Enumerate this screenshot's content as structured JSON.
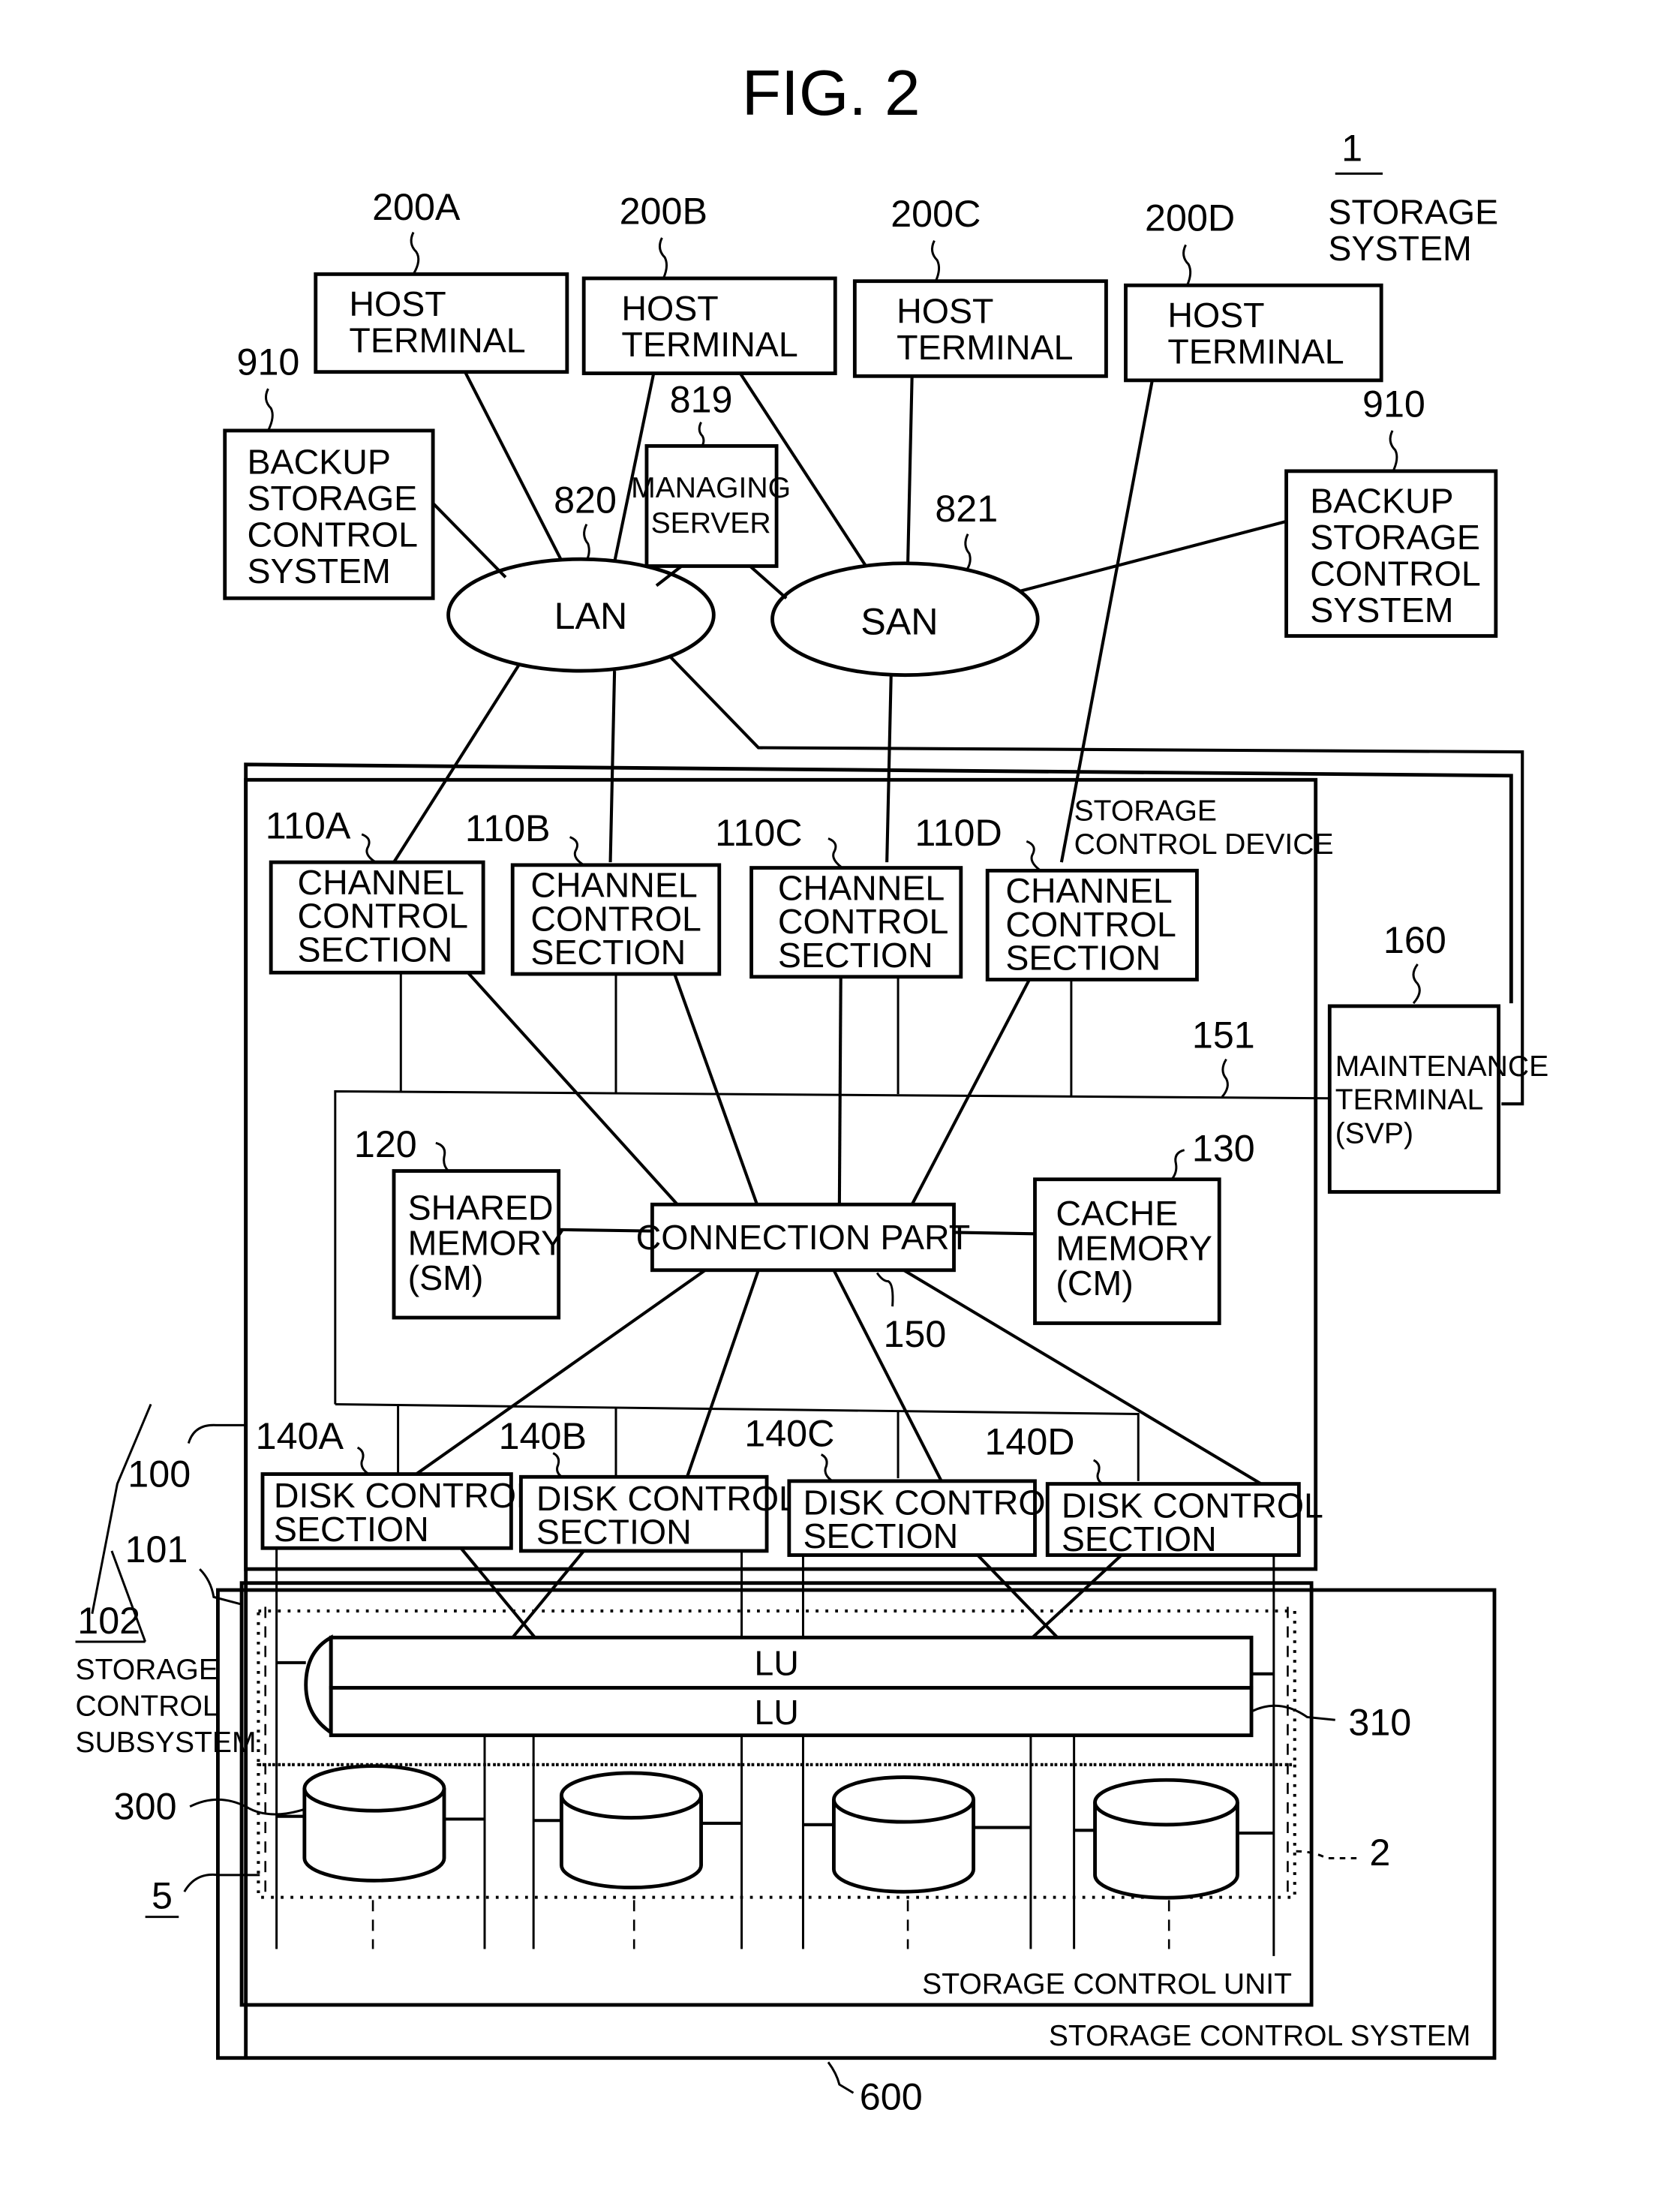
{
  "figure": {
    "title": "FIG. 2",
    "system_ref": "1",
    "system_label": [
      "STORAGE",
      "SYSTEM"
    ]
  },
  "hosts": [
    {
      "ref": "200A",
      "label": [
        "HOST",
        "TERMINAL"
      ]
    },
    {
      "ref": "200B",
      "label": [
        "HOST",
        "TERMINAL"
      ]
    },
    {
      "ref": "200C",
      "label": [
        "HOST",
        "TERMINAL"
      ]
    },
    {
      "ref": "200D",
      "label": [
        "HOST",
        "TERMINAL"
      ]
    }
  ],
  "backup_left": {
    "ref": "910",
    "label": [
      "BACKUP",
      "STORAGE",
      "CONTROL",
      "SYSTEM"
    ]
  },
  "backup_right": {
    "ref": "910",
    "label": [
      "BACKUP",
      "STORAGE",
      "CONTROL",
      "SYSTEM"
    ]
  },
  "managing_server": {
    "ref": "819",
    "label": [
      "MANAGING",
      "SERVER"
    ]
  },
  "lan": {
    "ref": "820",
    "label": "LAN"
  },
  "san": {
    "ref": "821",
    "label": "SAN"
  },
  "storage_control_device": {
    "label": [
      "STORAGE",
      "CONTROL DEVICE"
    ]
  },
  "channel_sections": [
    {
      "ref": "110A",
      "label": [
        "CHANNEL",
        "CONTROL",
        "SECTION"
      ]
    },
    {
      "ref": "110B",
      "label": [
        "CHANNEL",
        "CONTROL",
        "SECTION"
      ]
    },
    {
      "ref": "110C",
      "label": [
        "CHANNEL",
        "CONTROL",
        "SECTION"
      ]
    },
    {
      "ref": "110D",
      "label": [
        "CHANNEL",
        "CONTROL",
        "SECTION"
      ]
    }
  ],
  "internal_lan_ref": "151",
  "maintenance_terminal": {
    "ref": "160",
    "label": [
      "MAINTENANCE",
      "TERMINAL",
      "(SVP)"
    ]
  },
  "shared_memory": {
    "ref": "120",
    "label": [
      "SHARED",
      "MEMORY",
      "(SM)"
    ]
  },
  "connection_part": {
    "ref": "150",
    "label": "CONNECTION PART"
  },
  "cache_memory": {
    "ref": "130",
    "label": [
      "CACHE",
      "MEMORY",
      "(CM)"
    ]
  },
  "disk_sections": [
    {
      "ref": "140A",
      "label": [
        "DISK CONTROL",
        "SECTION"
      ]
    },
    {
      "ref": "140B",
      "label": [
        "DISK CONTROL",
        "SECTION"
      ]
    },
    {
      "ref": "140C",
      "label": [
        "DISK CONTROL",
        "SECTION"
      ]
    },
    {
      "ref": "140D",
      "label": [
        "DISK CONTROL",
        "SECTION"
      ]
    }
  ],
  "side_refs": {
    "controller_ref": "100",
    "unit_ref": "101",
    "subsystem_ref": "102",
    "subsystem_label": [
      "STORAGE",
      "CONTROL",
      "SUBSYSTEM"
    ],
    "disk_ref": "300",
    "disk_area_ref": "5",
    "lu_ref": "310",
    "storage_device_ref": "2",
    "system_ref": "600"
  },
  "lus": [
    "LU",
    "LU"
  ],
  "storage_control_unit_label": "STORAGE CONTROL UNIT",
  "storage_control_system_label": "STORAGE CONTROL SYSTEM"
}
